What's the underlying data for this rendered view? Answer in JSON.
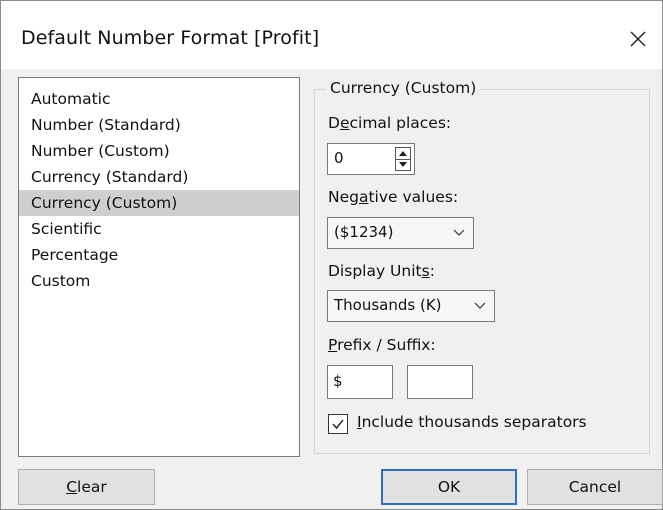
{
  "window": {
    "title": "Default Number Format [Profit]",
    "close_icon": "close-icon"
  },
  "format_list": {
    "items": [
      {
        "label": "Automatic"
      },
      {
        "label": "Number (Standard)"
      },
      {
        "label": "Number (Custom)"
      },
      {
        "label": "Currency (Standard)"
      },
      {
        "label": "Currency (Custom)",
        "selected": true
      },
      {
        "label": "Scientific"
      },
      {
        "label": "Percentage"
      },
      {
        "label": "Custom"
      }
    ]
  },
  "options": {
    "group_title": "Currency (Custom)",
    "decimal_places": {
      "label_pre": "D",
      "label_u": "e",
      "label_post": "cimal places:",
      "value": "0"
    },
    "negative_values": {
      "label_pre": "Neg",
      "label_u": "a",
      "label_post": "tive values:",
      "value": "($1234)"
    },
    "display_units": {
      "label_pre": "Display Unit",
      "label_u": "s",
      "label_post": ":",
      "value": "Thousands (K)"
    },
    "prefix_suffix": {
      "label_pre": "",
      "label_u": "P",
      "label_post": "refix / Suffix:",
      "prefix": "$",
      "suffix": ""
    },
    "thousands_separators": {
      "checked": true,
      "label_u": "I",
      "label_post": "nclude thousands separators"
    }
  },
  "buttons": {
    "clear_u": "C",
    "clear_post": "lear",
    "ok": "OK",
    "cancel": "Cancel"
  }
}
